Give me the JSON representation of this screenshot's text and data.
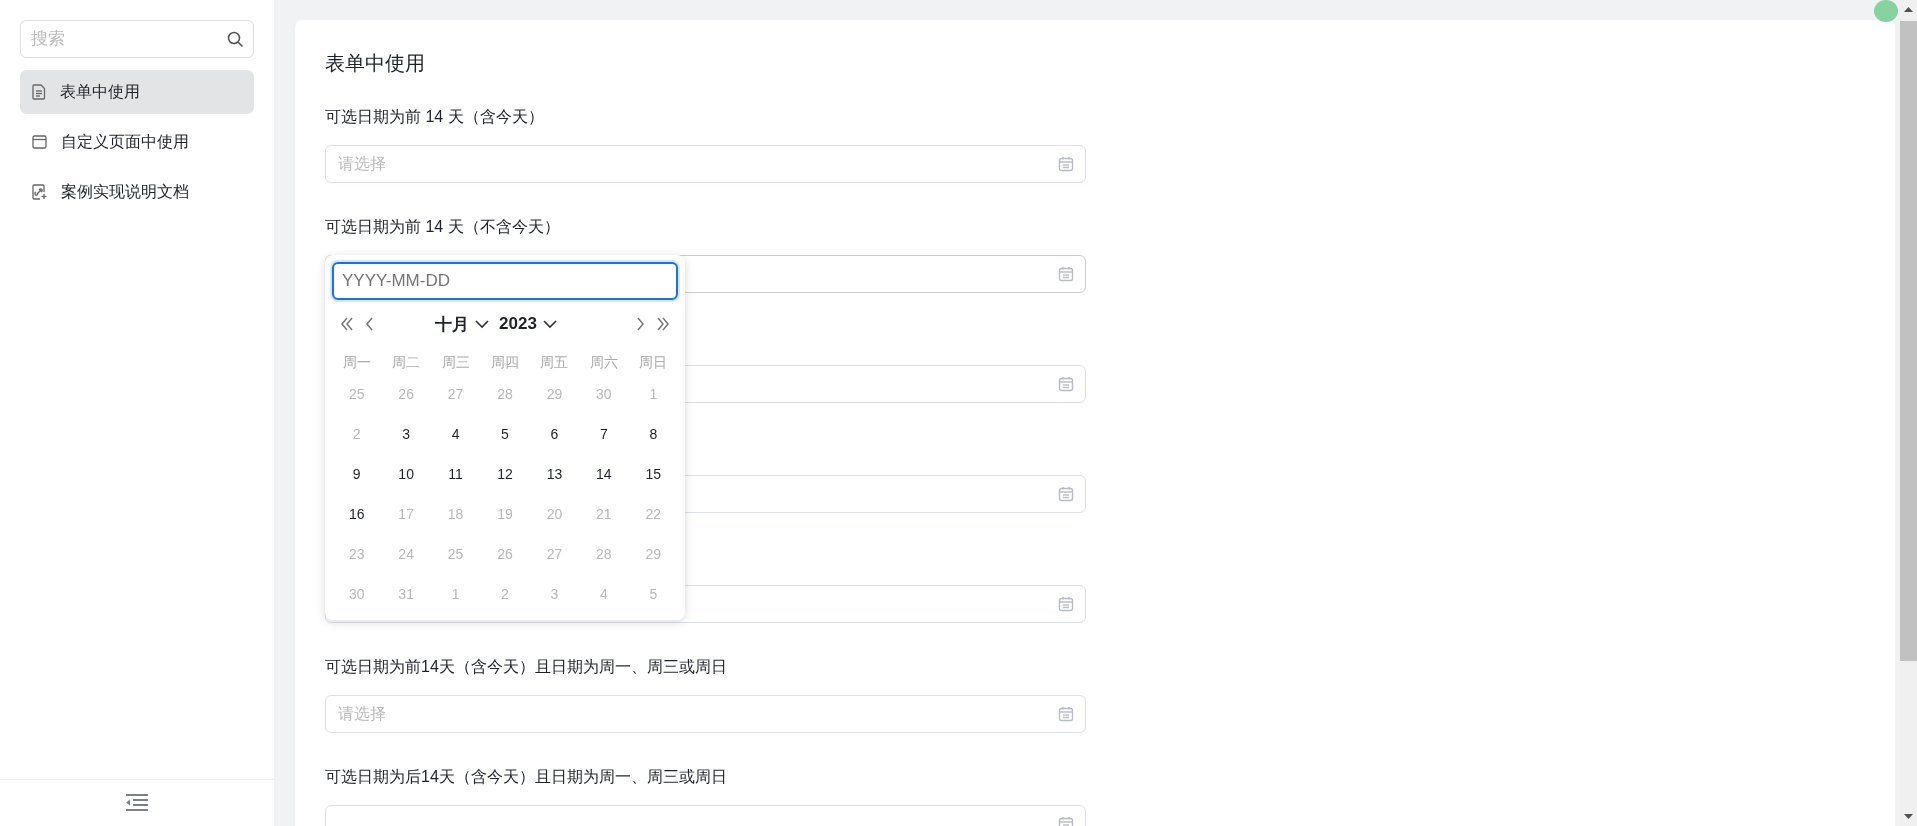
{
  "sidebar": {
    "search": {
      "placeholder": "搜索"
    },
    "items": [
      {
        "label": "表单中使用",
        "selected": true
      },
      {
        "label": "自定义页面中使用",
        "selected": false
      },
      {
        "label": "案例实现说明文档",
        "selected": false
      }
    ]
  },
  "form": {
    "title": "表单中使用",
    "fields": [
      {
        "label": "可选日期为前 14 天（含今天）",
        "placeholder": "请选择",
        "open": false
      },
      {
        "label": "可选日期为前 14 天（不含今天）",
        "open": true
      },
      {
        "open": false
      },
      {
        "open": false
      },
      {
        "open": false
      },
      {
        "label": "可选日期为前14天（含今天）且日期为周一、周三或周日",
        "placeholder": "请选择",
        "open": false
      },
      {
        "label": "可选日期为后14天（含今天）且日期为周一、周三或周日",
        "open": false
      }
    ]
  },
  "date_picker": {
    "placeholder": "YYYY-MM-DD",
    "month": "十月",
    "year": "2023",
    "weekdays": [
      "周一",
      "周二",
      "周三",
      "周四",
      "周五",
      "周六",
      "周日"
    ],
    "weeks": [
      [
        {
          "day": "25",
          "disabled": true
        },
        {
          "day": "26",
          "disabled": true
        },
        {
          "day": "27",
          "disabled": true
        },
        {
          "day": "28",
          "disabled": true
        },
        {
          "day": "29",
          "disabled": true
        },
        {
          "day": "30",
          "disabled": true
        },
        {
          "day": "1",
          "disabled": true
        }
      ],
      [
        {
          "day": "2",
          "disabled": true
        },
        {
          "day": "3",
          "disabled": false
        },
        {
          "day": "4",
          "disabled": false
        },
        {
          "day": "5",
          "disabled": false
        },
        {
          "day": "6",
          "disabled": false
        },
        {
          "day": "7",
          "disabled": false
        },
        {
          "day": "8",
          "disabled": false
        }
      ],
      [
        {
          "day": "9",
          "disabled": false
        },
        {
          "day": "10",
          "disabled": false
        },
        {
          "day": "11",
          "disabled": false
        },
        {
          "day": "12",
          "disabled": false
        },
        {
          "day": "13",
          "disabled": false
        },
        {
          "day": "14",
          "disabled": false
        },
        {
          "day": "15",
          "disabled": false
        }
      ],
      [
        {
          "day": "16",
          "disabled": false
        },
        {
          "day": "17",
          "disabled": true
        },
        {
          "day": "18",
          "disabled": true
        },
        {
          "day": "19",
          "disabled": true
        },
        {
          "day": "20",
          "disabled": true
        },
        {
          "day": "21",
          "disabled": true
        },
        {
          "day": "22",
          "disabled": true
        }
      ],
      [
        {
          "day": "23",
          "disabled": true
        },
        {
          "day": "24",
          "disabled": true
        },
        {
          "day": "25",
          "disabled": true
        },
        {
          "day": "26",
          "disabled": true
        },
        {
          "day": "27",
          "disabled": true
        },
        {
          "day": "28",
          "disabled": true
        },
        {
          "day": "29",
          "disabled": true
        }
      ],
      [
        {
          "day": "30",
          "disabled": true
        },
        {
          "day": "31",
          "disabled": true
        },
        {
          "day": "1",
          "disabled": true
        },
        {
          "day": "2",
          "disabled": true
        },
        {
          "day": "3",
          "disabled": true
        },
        {
          "day": "4",
          "disabled": true
        },
        {
          "day": "5",
          "disabled": true
        }
      ]
    ]
  }
}
